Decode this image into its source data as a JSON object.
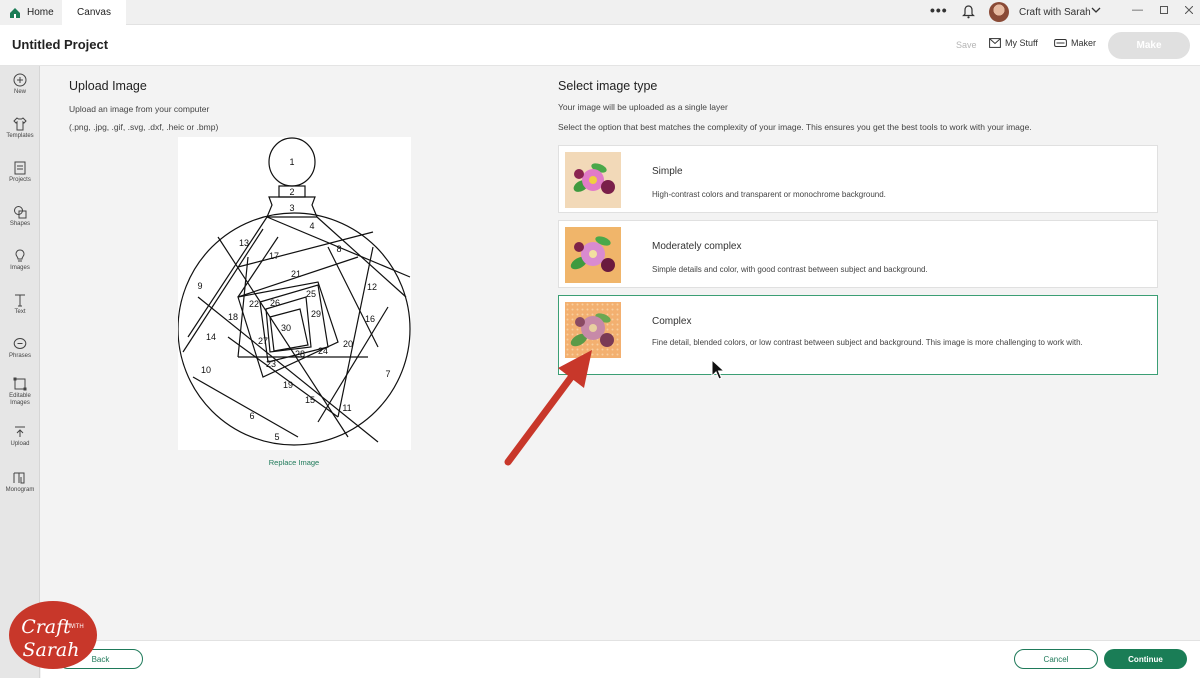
{
  "tabs": {
    "home": "Home",
    "canvas": "Canvas"
  },
  "topbar": {
    "user_name": "Craft with Sarah",
    "more": "•••"
  },
  "header": {
    "project_title": "Untitled Project",
    "save": "Save",
    "my_stuff": "My Stuff",
    "maker": "Maker",
    "make": "Make"
  },
  "sidebar": {
    "items": [
      {
        "label": "New",
        "icon": "plus-circle-icon"
      },
      {
        "label": "Templates",
        "icon": "shirt-icon"
      },
      {
        "label": "Projects",
        "icon": "projects-icon"
      },
      {
        "label": "Shapes",
        "icon": "shapes-icon"
      },
      {
        "label": "Images",
        "icon": "lightbulb-icon"
      },
      {
        "label": "Text",
        "icon": "text-icon"
      },
      {
        "label": "Phrases",
        "icon": "speech-bubble-icon"
      },
      {
        "label": "Editable Images",
        "icon": "editable-image-icon"
      },
      {
        "label": "Upload",
        "icon": "upload-icon"
      },
      {
        "label": "Monogram",
        "icon": "monogram-icon"
      }
    ]
  },
  "upload": {
    "heading": "Upload Image",
    "line1": "Upload an image from your computer",
    "line2": "(.png, .jpg, .gif, .svg, .dxf, .heic or .bmp)",
    "replace": "Replace Image",
    "numbers": [
      "1",
      "2",
      "3",
      "4",
      "5",
      "6",
      "7",
      "8",
      "9",
      "10",
      "11",
      "12",
      "13",
      "14",
      "15",
      "16",
      "17",
      "18",
      "19",
      "20",
      "21",
      "22",
      "23",
      "24",
      "25",
      "26",
      "27",
      "28",
      "29",
      "30"
    ]
  },
  "select": {
    "heading": "Select image type",
    "line1": "Your image will be uploaded as a single layer",
    "line2": "Select the option that best matches the complexity of your image. This ensures you get the best tools to work with your image.",
    "options": [
      {
        "title": "Simple",
        "desc": "High-contrast colors and transparent or monochrome background.",
        "bg": "#f2d9b8"
      },
      {
        "title": "Moderately complex",
        "desc": "Simple details and color, with good contrast between subject and background.",
        "bg": "#f0b56a"
      },
      {
        "title": "Complex",
        "desc": "Fine detail, blended colors, or low contrast between subject and background. This image is more challenging to work with.",
        "bg": "#f3b070"
      }
    ]
  },
  "footer": {
    "back": "Back",
    "cancel": "Cancel",
    "continue": "Continue"
  },
  "watermark": {
    "line1": "Craft",
    "line2": "with",
    "line3": "Sarah"
  },
  "colors": {
    "accent": "#1a7d56",
    "arrow": "#c8372a",
    "selected_border": "#3b9e74"
  }
}
